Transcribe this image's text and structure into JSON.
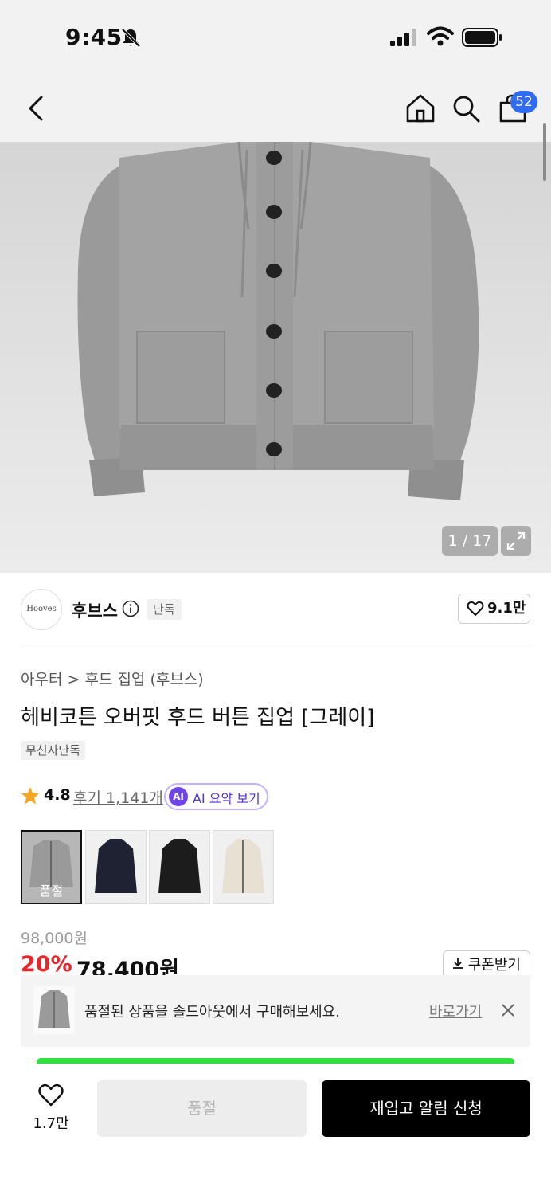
{
  "status_bar": {
    "time": "9:45"
  },
  "header": {
    "cart_count": "52"
  },
  "gallery": {
    "counter": "1 / 17"
  },
  "brand": {
    "logo_text": "Hooves",
    "name": "후브스",
    "badge": "단독",
    "like_count": "9.1만"
  },
  "product": {
    "breadcrumb": "아우터 > 후드 집업 (후브스)",
    "title": "헤비코튼 오버핏 후드 버튼 집업 [그레이]",
    "badge": "무신사단독",
    "rating": "4.8",
    "review_label": "후기 1,141개",
    "ai_icon": "AI",
    "ai_summary_label": "AI 요약 보기",
    "swatch_soldout_label": "품절",
    "swatch_colors": [
      "#9a9a9a",
      "#1e2233",
      "#1c1c1c",
      "#e8e0d2"
    ],
    "original_price": "98,000원",
    "discount": "20%",
    "sale_price": "78,400원",
    "coupon_label": "쿠폰받기"
  },
  "banner": {
    "text": "품절된 상품을 솔드아웃에서 구매해보세요.",
    "link": "바로가기"
  },
  "bottom_bar": {
    "wishlist_count": "1.7만",
    "soldout_label": "품절",
    "restock_label": "재입고 알림 신청"
  },
  "colors": {
    "accent_blue": "#2f6bf5",
    "discount_red": "#e8262a",
    "ai_purple": "#6f44e8",
    "star": "#f5a623"
  },
  "icons": [
    "bell-off-icon",
    "signal-icon",
    "wifi-icon",
    "battery-icon",
    "back-icon",
    "home-icon",
    "search-icon",
    "cart-icon",
    "expand-icon",
    "info-icon",
    "heart-icon",
    "star-icon",
    "download-icon",
    "close-icon"
  ]
}
